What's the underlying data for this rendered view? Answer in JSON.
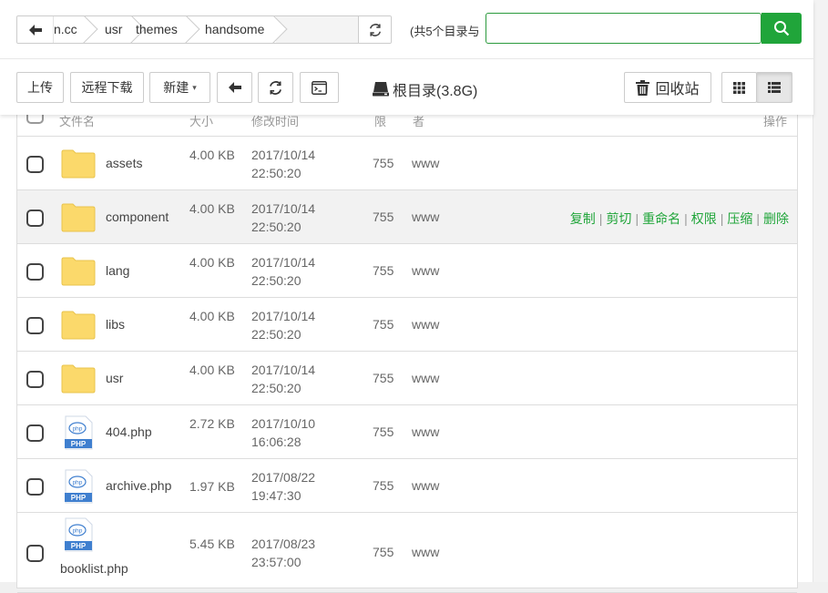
{
  "breadcrumb": {
    "items": [
      "n.cc",
      "usr",
      "themes",
      "handsome"
    ]
  },
  "summary": {
    "count_text": "(共5个目录与"
  },
  "search": {
    "placeholder": ""
  },
  "toolbar": {
    "upload": "上传",
    "remote_download": "远程下载",
    "new": "新建",
    "root_label": "根目录(3.8G)",
    "recycle": "回收站"
  },
  "table": {
    "headers": {
      "name": "文件名",
      "size": "大小",
      "mtime": "修改时间",
      "perm": "限",
      "owner": "者",
      "ops": "操作"
    },
    "rows": [
      {
        "type": "folder",
        "name": "assets",
        "size": "4.00 KB",
        "date": "2017/10/14",
        "time": "22:50:20",
        "perm": "755",
        "owner": "www"
      },
      {
        "type": "folder",
        "name": "component",
        "size": "4.00 KB",
        "date": "2017/10/14",
        "time": "22:50:20",
        "perm": "755",
        "owner": "www"
      },
      {
        "type": "folder",
        "name": "lang",
        "size": "4.00 KB",
        "date": "2017/10/14",
        "time": "22:50:20",
        "perm": "755",
        "owner": "www"
      },
      {
        "type": "folder",
        "name": "libs",
        "size": "4.00 KB",
        "date": "2017/10/14",
        "time": "22:50:20",
        "perm": "755",
        "owner": "www"
      },
      {
        "type": "folder",
        "name": "usr",
        "size": "4.00 KB",
        "date": "2017/10/14",
        "time": "22:50:20",
        "perm": "755",
        "owner": "www"
      },
      {
        "type": "php",
        "name": "404.php",
        "size": "2.72 KB",
        "date": "2017/10/10",
        "time": "16:06:28",
        "perm": "755",
        "owner": "www"
      },
      {
        "type": "php",
        "name": "archive.php",
        "size": "1.97 KB",
        "date": "2017/08/22",
        "time": "19:47:30",
        "perm": "755",
        "owner": "www"
      },
      {
        "type": "php",
        "name": "booklist.php",
        "size": "5.45 KB",
        "date": "2017/08/23",
        "time": "23:57:00",
        "perm": "755",
        "owner": "www"
      }
    ],
    "row_actions": [
      "复制",
      "剪切",
      "重命名",
      "权限",
      "压缩",
      "删除"
    ],
    "hover_row": 1
  },
  "icons": {
    "php_label": "PHP",
    "php_badge": "php"
  },
  "colors": {
    "accent": "#20a53a",
    "folder": "#fbd96b",
    "php_blue": "#3f7fcf"
  }
}
